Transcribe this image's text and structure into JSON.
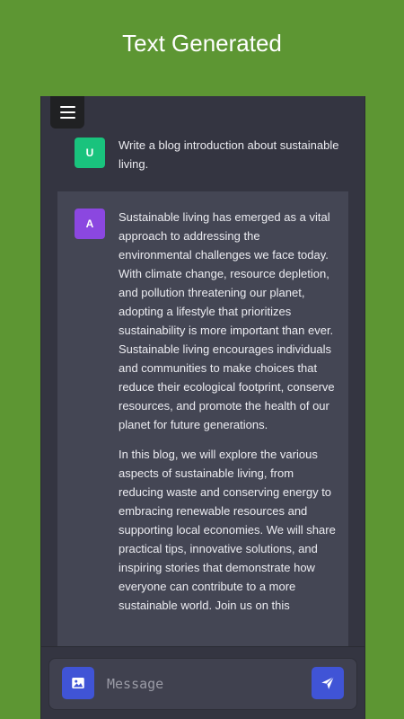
{
  "banner": {
    "title": "Text Generated"
  },
  "header": {
    "menu_icon": "hamburger-menu-icon"
  },
  "conversation": {
    "user": {
      "avatar_letter": "U",
      "avatar_color": "#19c37d",
      "text": "Write a blog introduction about sustainable living."
    },
    "assistant": {
      "avatar_letter": "A",
      "avatar_color": "#8b47e0",
      "paragraphs": [
        "Sustainable living has emerged as a vital approach to addressing the environmental challenges we face today. With climate change, resource depletion, and pollution threatening our planet, adopting a lifestyle that prioritizes sustainability is more important than ever. Sustainable living encourages individuals and communities to make choices that reduce their ecological footprint, conserve resources, and promote the health of our planet for future generations.",
        "In this blog, we will explore the various aspects of sustainable living, from reducing waste and conserving energy to embracing renewable resources and supporting local economies. We will share practical tips, innovative solutions, and inspiring stories that demonstrate how everyone can contribute to a more sustainable world. Join us on this"
      ]
    }
  },
  "composer": {
    "placeholder": "Message",
    "image_icon": "image-icon",
    "send_icon": "send-icon",
    "accent_color": "#4054d6"
  },
  "colors": {
    "background": "#5d9633",
    "chat_background": "#343541",
    "assistant_background": "#444654"
  }
}
